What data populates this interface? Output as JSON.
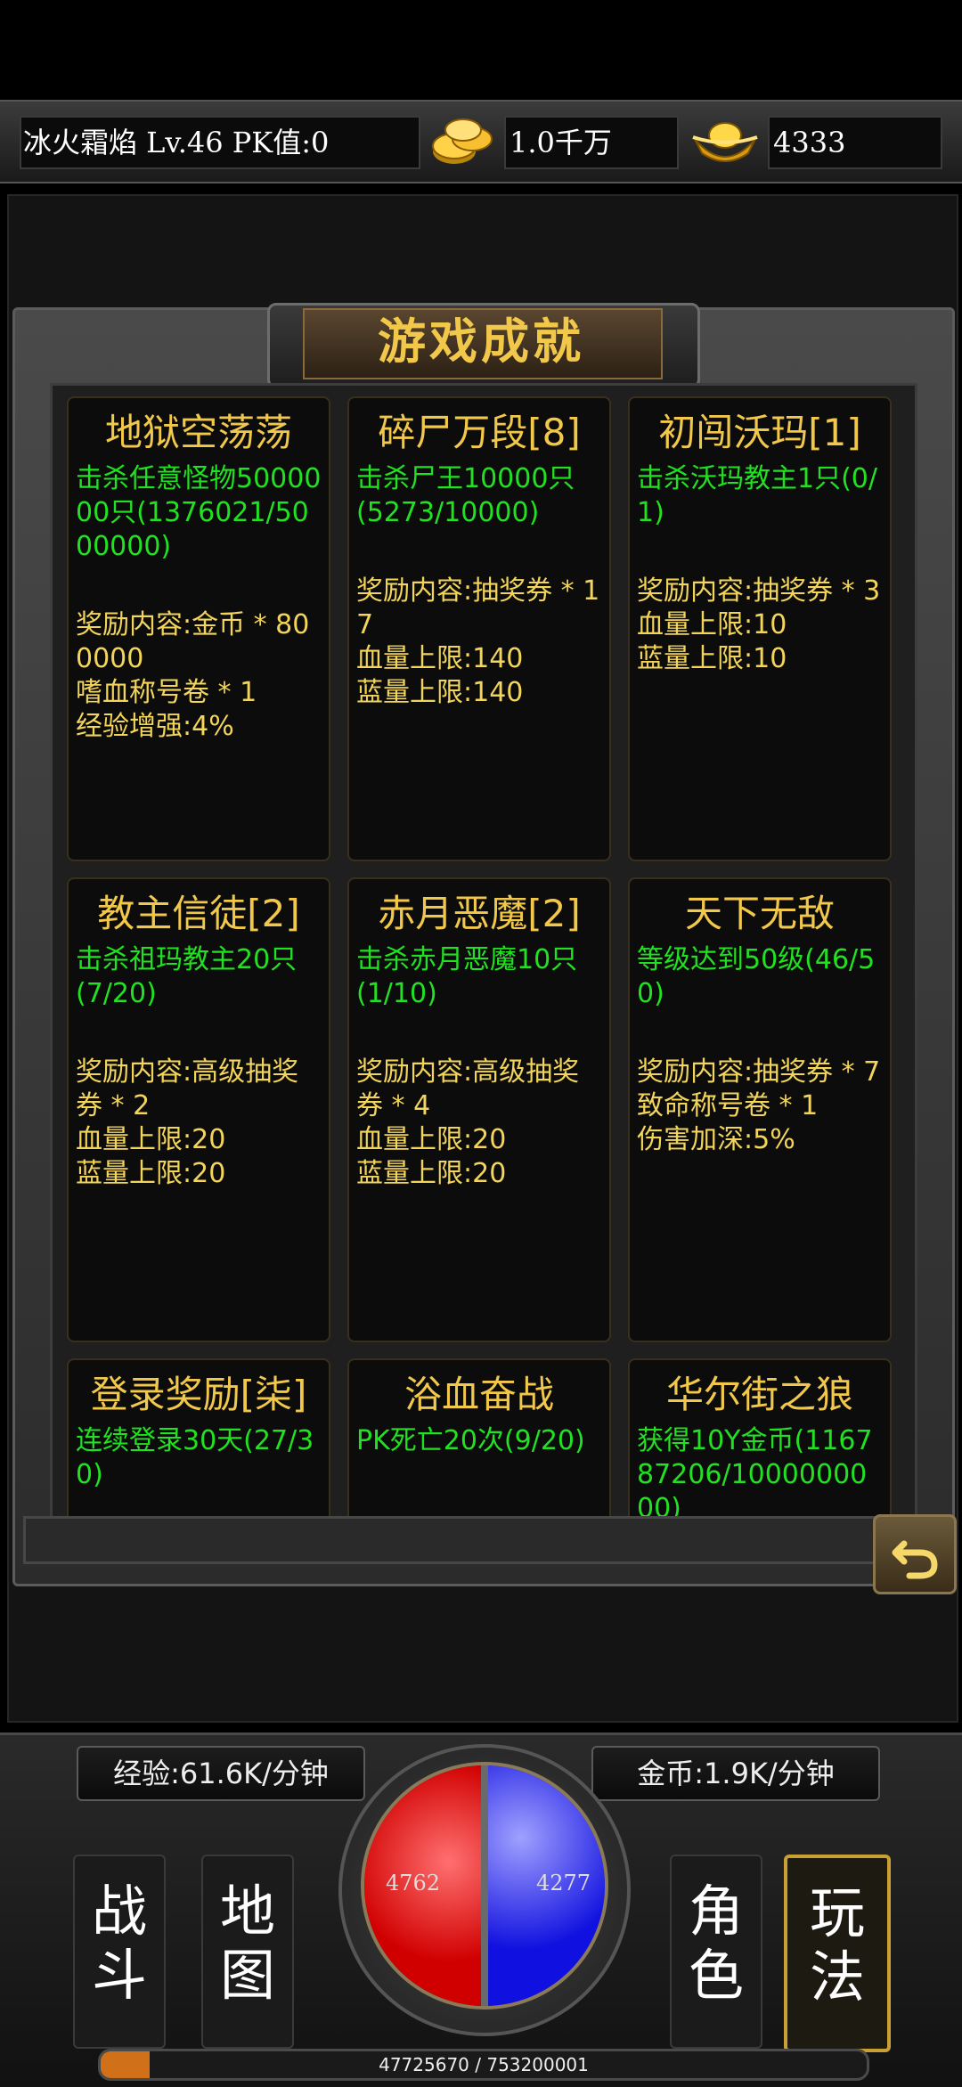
{
  "header": {
    "player_info": "冰火霜焰  Lv.46 PK值:0",
    "gold": "1.0千万",
    "ingots": "4333"
  },
  "page_title": "游戏成就",
  "achievements": [
    {
      "title": "地狱空荡荡",
      "task": "击杀任意怪物5000000只(1376021/5000000)",
      "reward": "奖励内容:金币 * 800000\n嗜血称号卷 * 1\n经验增强:4%"
    },
    {
      "title": "碎尸万段[8]",
      "task": "击杀尸王10000只(5273/10000)",
      "reward": "奖励内容:抽奖券 * 17\n血量上限:140\n蓝量上限:140"
    },
    {
      "title": "初闯沃玛[1]",
      "task": "击杀沃玛教主1只(0/1)",
      "reward": "奖励内容:抽奖券 * 3\n血量上限:10\n蓝量上限:10"
    },
    {
      "title": "教主信徒[2]",
      "task": "击杀祖玛教主20只(7/20)",
      "reward": "奖励内容:高级抽奖券 * 2\n血量上限:20\n蓝量上限:20"
    },
    {
      "title": "赤月恶魔[2]",
      "task": "击杀赤月恶魔10只(1/10)",
      "reward": "奖励内容:高级抽奖券 * 4\n血量上限:20\n蓝量上限:20"
    },
    {
      "title": "天下无敌",
      "task": "等级达到50级(46/50)",
      "reward": "奖励内容:抽奖券 * 7  致命称号卷 * 1\n伤害加深:5%"
    },
    {
      "title": "登录奖励[柒]",
      "task": "连续登录30天(27/30)",
      "reward": ""
    },
    {
      "title": "浴血奋战",
      "task": "PK死亡20次(9/20)",
      "reward": ""
    },
    {
      "title": "华尔街之狼",
      "task": "获得10Y金币(116787206/1000000000)",
      "reward": ""
    }
  ],
  "hud": {
    "exp_rate": "经验:61.6K/分钟",
    "gold_rate": "金币:1.9K/分钟",
    "hp": "4762",
    "mp": "4277",
    "exp_text": "47725670 / 753200001",
    "exp_progress": 0.0634
  },
  "nav": [
    {
      "label": "战\n斗"
    },
    {
      "label": "地\n图"
    },
    {
      "label": "角\n色"
    },
    {
      "label": "玩\n法"
    }
  ],
  "icons": {
    "gold": "gold-coins-icon",
    "ingot": "gold-ingot-icon",
    "back": "back-arrow-icon"
  }
}
